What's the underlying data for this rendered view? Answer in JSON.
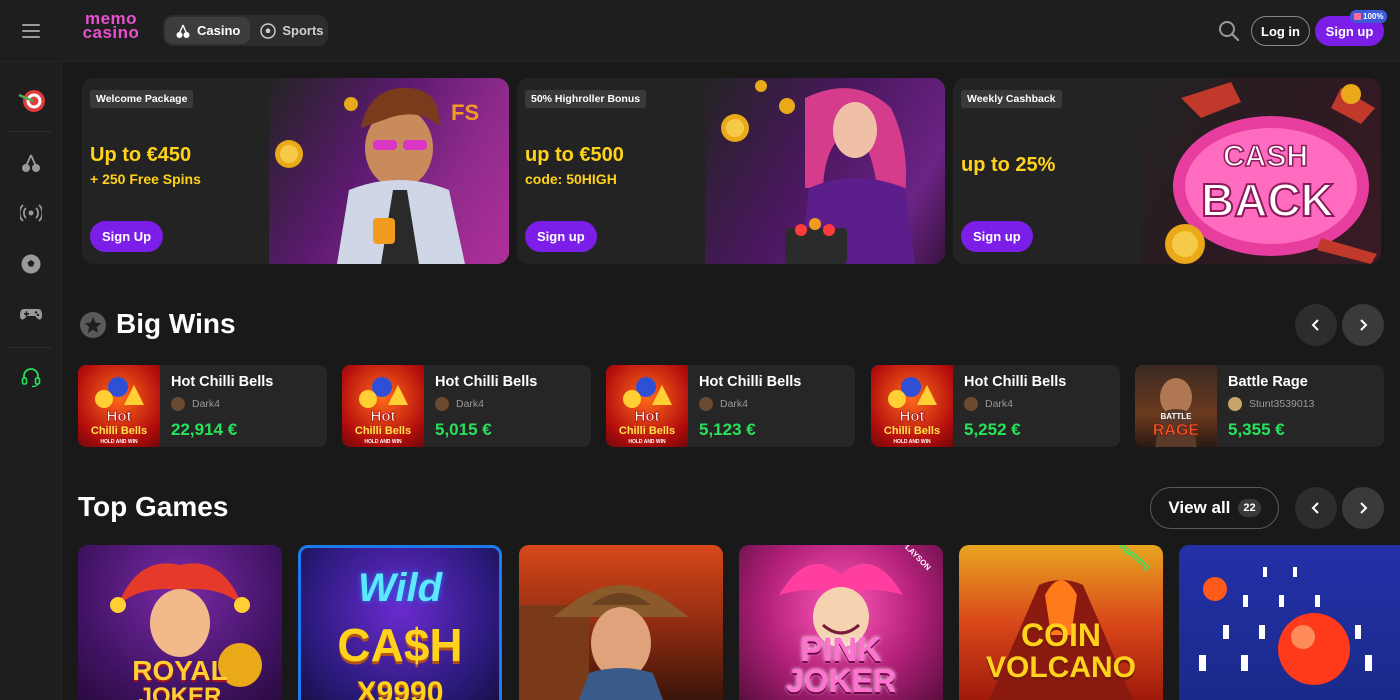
{
  "header": {
    "logo_line1": "memo",
    "logo_line2": "casino",
    "tabs": [
      {
        "label": "Casino",
        "active": true
      },
      {
        "label": "Sports",
        "active": false
      }
    ],
    "login_label": "Log in",
    "signup_label": "Sign up",
    "signup_badge": "100%"
  },
  "sidebar": {
    "items": [
      "target-icon",
      "cherry-icon",
      "live-broadcast-icon",
      "soccer-ball-icon",
      "gamepad-icon",
      "headset-icon"
    ]
  },
  "banners": [
    {
      "tag": "Welcome Package",
      "headline": "Up to €450",
      "sub": "+ 250 Free Spins",
      "button": "Sign Up",
      "art_text": "FS"
    },
    {
      "tag": "50% Highroller Bonus",
      "headline": "up to €500",
      "sub": "code: 50HIGH",
      "button": "Sign up"
    },
    {
      "tag": "Weekly Cashback",
      "headline": "up to 25%",
      "sub": "",
      "button": "Sign up",
      "art_text_1": "CASH",
      "art_text_2": "BACK"
    }
  ],
  "big_wins": {
    "title": "Big Wins",
    "items": [
      {
        "game": "Hot Chilli Bells",
        "user": "Dark4",
        "amount": "22,914 €",
        "thumb_l1": "Hot",
        "thumb_l2": "Chilli Bells",
        "thumb_l3": "HOLD AND WIN"
      },
      {
        "game": "Hot Chilli Bells",
        "user": "Dark4",
        "amount": "5,015 €",
        "thumb_l1": "Hot",
        "thumb_l2": "Chilli Bells",
        "thumb_l3": "HOLD AND WIN"
      },
      {
        "game": "Hot Chilli Bells",
        "user": "Dark4",
        "amount": "5,123 €",
        "thumb_l1": "Hot",
        "thumb_l2": "Chilli Bells",
        "thumb_l3": "HOLD AND WIN"
      },
      {
        "game": "Hot Chilli Bells",
        "user": "Dark4",
        "amount": "5,252 €",
        "thumb_l1": "Hot",
        "thumb_l2": "Chilli Bells",
        "thumb_l3": "HOLD AND WIN"
      },
      {
        "game": "Battle Rage",
        "user": "Stunt3539013",
        "amount": "5,355 €",
        "thumb_l1": "BATTLE",
        "thumb_l2": "RAGE"
      }
    ]
  },
  "top_games": {
    "title": "Top Games",
    "view_all_label": "View all",
    "count": "22",
    "tiles": [
      {
        "t1": "ROYAL",
        "t2": "JOKER"
      },
      {
        "t1": "Wild",
        "t2": "CA$H",
        "t3": "X9990"
      },
      {
        "t1": ""
      },
      {
        "t1": "PINK",
        "t2": "JOKER",
        "provider": "PLAYSON"
      },
      {
        "t1": "COIN",
        "t2": "VOLCANO",
        "provider": "bgaming"
      },
      {
        "t1": ""
      }
    ]
  },
  "colors": {
    "accent": "#7b1fe8",
    "highlight": "#ffd21c",
    "win": "#27e35a",
    "bg": "#191919"
  }
}
